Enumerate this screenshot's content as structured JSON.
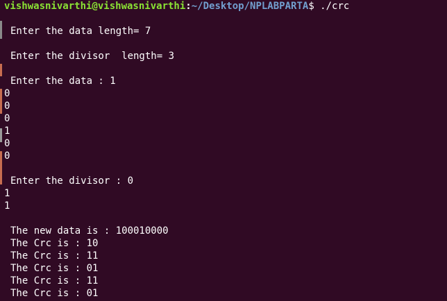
{
  "prompt": {
    "user_host": "vishwasnivarthi@vishwasnivarthi",
    "colon": ":",
    "path": "~/Desktop/NPLABPARTA",
    "dollar": "$",
    "command": " ./crc"
  },
  "output": {
    "data_length": "Enter the data length= 7",
    "divisor_length": "Enter the divisor  length= 3",
    "data_prompt": "Enter the data : 1",
    "data_bits": [
      "0",
      "0",
      "0",
      "1",
      "0",
      "0"
    ],
    "divisor_prompt": "Enter the divisor : 0",
    "divisor_bits": [
      "1",
      "1"
    ],
    "new_data": "The new data is : 100010000",
    "crc_lines": [
      "The Crc is : 10",
      "The Crc is : 11",
      "The Crc is : 01",
      "The Crc is : 11",
      "The Crc is : 01"
    ]
  },
  "colors": {
    "background": "#300a24",
    "prompt_user": "#8ae234",
    "prompt_path": "#729fcf",
    "text": "#ffffff"
  }
}
